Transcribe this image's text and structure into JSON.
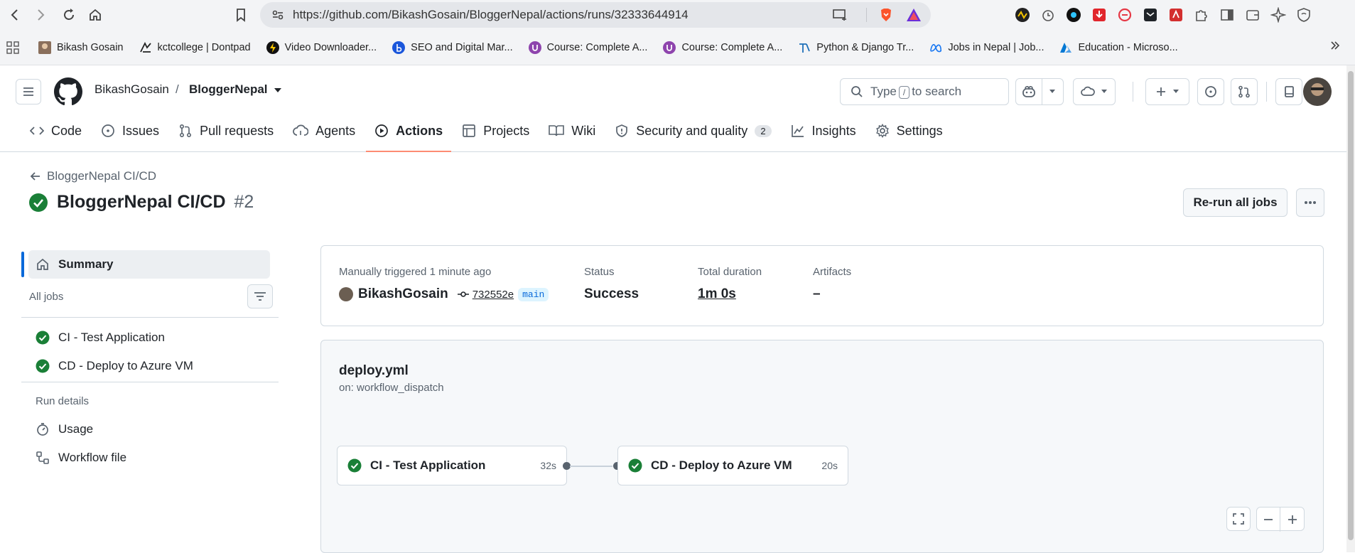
{
  "browser": {
    "url": "https://github.com/BikashGosain/BloggerNepal/actions/runs/32333644914",
    "bookmarks": [
      {
        "label": "Bikash Gosain",
        "icon": "profile-photo-icon"
      },
      {
        "label": "kctcollege | Dontpad",
        "icon": "dontpad-icon"
      },
      {
        "label": "Video Downloader...",
        "icon": "lightning-icon"
      },
      {
        "label": "SEO and Digital Mar...",
        "icon": "b-circle-icon"
      },
      {
        "label": "Course: Complete A...",
        "icon": "course-icon"
      },
      {
        "label": "Course: Complete A...",
        "icon": "course-icon"
      },
      {
        "label": "Python & Django Tr...",
        "icon": "python-django-icon"
      },
      {
        "label": "Jobs in Nepal | Job...",
        "icon": "meta-icon"
      },
      {
        "label": "Education - Microso...",
        "icon": "azure-icon"
      }
    ]
  },
  "header": {
    "owner": "BikashGosain",
    "separator": "/",
    "repo": "BloggerNepal",
    "search_prefix": "Type",
    "search_key": "/",
    "search_suffix": "to search"
  },
  "tabs": [
    {
      "label": "Code",
      "icon": "code-icon"
    },
    {
      "label": "Issues",
      "icon": "issue-icon"
    },
    {
      "label": "Pull requests",
      "icon": "pull-request-icon"
    },
    {
      "label": "Agents",
      "icon": "agents-icon"
    },
    {
      "label": "Actions",
      "icon": "play-icon",
      "active": true
    },
    {
      "label": "Projects",
      "icon": "table-icon"
    },
    {
      "label": "Wiki",
      "icon": "book-icon"
    },
    {
      "label": "Security and quality",
      "icon": "shield-icon",
      "count": "2"
    },
    {
      "label": "Insights",
      "icon": "graph-icon"
    },
    {
      "label": "Settings",
      "icon": "gear-icon"
    }
  ],
  "run": {
    "back_label": "BloggerNepal CI/CD",
    "title": "BloggerNepal CI/CD",
    "number": "#2",
    "rerun_label": "Re-run all jobs"
  },
  "sidebar": {
    "summary_label": "Summary",
    "all_jobs_label": "All jobs",
    "jobs": [
      "CI - Test Application",
      "CD - Deploy to Azure VM"
    ],
    "run_details_label": "Run details",
    "usage_label": "Usage",
    "workflow_file_label": "Workflow file"
  },
  "summary": {
    "trigger_label": "Manually triggered 1 minute ago",
    "actor": "BikashGosain",
    "commit": "732552e",
    "branch": "main",
    "status_label": "Status",
    "status_value": "Success",
    "duration_label": "Total duration",
    "duration_value": "1m 0s",
    "artifacts_label": "Artifacts",
    "artifacts_value": "–"
  },
  "workflow": {
    "file": "deploy.yml",
    "trigger": "on: workflow_dispatch",
    "jobs": [
      {
        "name": "CI - Test Application",
        "duration": "32s"
      },
      {
        "name": "CD - Deploy to Azure VM",
        "duration": "20s"
      }
    ]
  },
  "colors": {
    "success": "#1a7f37",
    "accent": "#0969da",
    "tab_underline": "#fd8c73"
  }
}
